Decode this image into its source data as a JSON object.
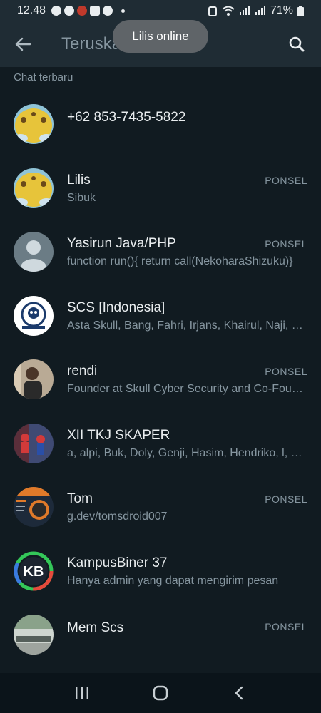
{
  "status": {
    "time": "12.48",
    "battery": "71%"
  },
  "appbar": {
    "title": "Teruskan"
  },
  "toast": {
    "text": "Lilis online"
  },
  "section": {
    "label": "Chat terbaru"
  },
  "colors": {
    "background": "#111b21",
    "appbar": "#1f2c34",
    "secondary_text": "#8696a0"
  },
  "chats": [
    {
      "name": "+62 853-7435-5822",
      "subtitle": "",
      "tag": "",
      "avatar": "yellow-sticker"
    },
    {
      "name": "Lilis",
      "subtitle": "Sibuk",
      "tag": "PONSEL",
      "avatar": "yellow-sticker"
    },
    {
      "name": "Yasirun Java/PHP",
      "subtitle": "function run(){ return call(NekoharaShizuku)}",
      "tag": "PONSEL",
      "avatar": "default-person"
    },
    {
      "name": "SCS [Indonesia]",
      "subtitle": "Asta Skull, Bang, Fahri, Irjans, Khairul, Naji, Naufal, Rendi",
      "tag": "",
      "avatar": "skull-logo"
    },
    {
      "name": "rendi",
      "subtitle": "Founder at Skull Cyber Security and Co-Founder",
      "tag": "PONSEL",
      "avatar": "photo-person"
    },
    {
      "name": "XII TKJ SKAPER",
      "subtitle": "a, alpi, Buk, Doly, Genji, Hasim, Hendriko, l, m, n",
      "tag": "",
      "avatar": "spiderman"
    },
    {
      "name": "Tom",
      "subtitle": "g.dev/tomsdroid007",
      "tag": "PONSEL",
      "avatar": "tom-poster"
    },
    {
      "name": "KampusBiner 37",
      "subtitle": "Hanya admin yang dapat mengirim pesan",
      "tag": "",
      "avatar": "kb-logo"
    },
    {
      "name": "Mem Scs",
      "subtitle": "",
      "tag": "PONSEL",
      "avatar": "photo-scene"
    }
  ],
  "navbar": {
    "recents": "recents-icon",
    "home": "home-icon",
    "back": "back-nav-icon"
  }
}
